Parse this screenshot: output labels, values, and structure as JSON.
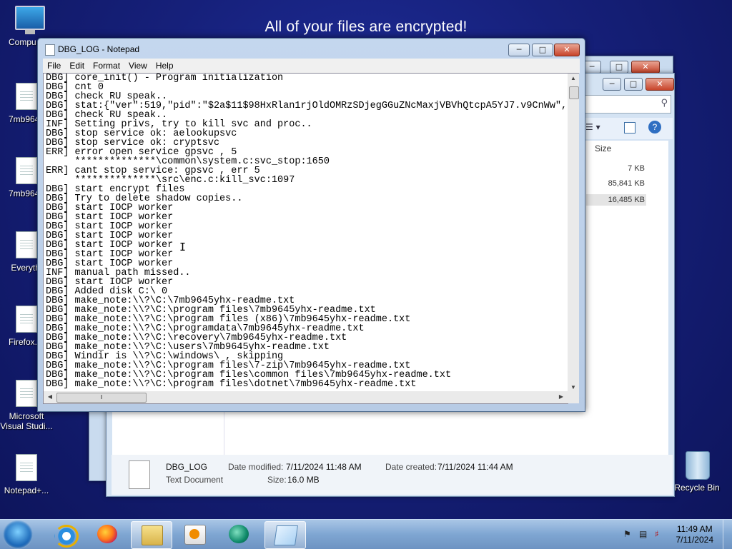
{
  "desktop": {
    "banner": "All of your files are encrypted!",
    "icons": [
      {
        "label": "Compu"
      },
      {
        "label": "7mb9645"
      },
      {
        "label": "7mb9645"
      },
      {
        "label": "Everythi"
      },
      {
        "label": "Firefox.In"
      },
      {
        "label": "Microsoft Visual Studi..."
      },
      {
        "label": "Notepad+..."
      },
      {
        "label": "Recycle Bin"
      }
    ]
  },
  "notepad": {
    "title": "DBG_LOG - Notepad",
    "menu": [
      "File",
      "Edit",
      "Format",
      "View",
      "Help"
    ],
    "lines": [
      "DBG] core_init() - Program initialization",
      "DBG] cnt 0",
      "DBG] check RU speak..",
      "DBG] stat:{\"ver\":519,\"pid\":\"$2a$11$98HxRlan1rjOldOMRzSDjegGGuZNcMaxjVBVhQtcpA5YJ7.v9CnWw\",\"",
      "DBG] check RU speak..",
      "INF] Setting privs, try to kill svc and proc..",
      "DBG] stop service ok: aelookupsvc",
      "DBG] stop service ok: cryptsvc",
      "ERR] error open service gpsvc , 5",
      "     **************\\common\\system.c:svc_stop:1650",
      "ERR] cant stop service: gpsvc , err 5",
      "     **************\\src\\enc.c:kill_svc:1097",
      "DBG] start encrypt files",
      "DBG] Try to delete shadow copies..",
      "DBG] start IOCP worker",
      "DBG] start IOCP worker",
      "DBG] start IOCP worker",
      "DBG] start IOCP worker",
      "DBG] start IOCP worker",
      "DBG] start IOCP worker",
      "DBG] start IOCP worker",
      "INF] manual path missed..",
      "DBG] start IOCP worker",
      "DBG] Added disk C:\\ 0",
      "DBG] make_note:\\\\?\\C:\\7mb9645yhx-readme.txt",
      "DBG] make_note:\\\\?\\C:\\program files\\7mb9645yhx-readme.txt",
      "DBG] make_note:\\\\?\\C:\\program files (x86)\\7mb9645yhx-readme.txt",
      "DBG] make_note:\\\\?\\C:\\programdata\\7mb9645yhx-readme.txt",
      "DBG] make_note:\\\\?\\C:\\recovery\\7mb9645yhx-readme.txt",
      "DBG] make_note:\\\\?\\C:\\users\\7mb9645yhx-readme.txt",
      "DBG] Windir is \\\\?\\C:\\windows\\ , skipping",
      "DBG] make_note:\\\\?\\C:\\program files\\7-zip\\7mb9645yhx-readme.txt",
      "DBG] make_note:\\\\?\\C:\\program files\\common files\\7mb9645yhx-readme.txt",
      "DBG] make_note:\\\\?\\C:\\program files\\dotnet\\7mb9645yhx-readme.txt"
    ]
  },
  "explorer": {
    "size_header": "Size",
    "sizes": [
      "7 KB",
      "85,841 KB",
      "16,485 KB"
    ],
    "details": {
      "name": "DBG_LOG",
      "type": "Text Document",
      "modified_label": "Date modified:",
      "modified_value": "7/11/2024 11:48 AM",
      "created_label": "Date created:",
      "created_value": "7/11/2024 11:44 AM",
      "size_label": "Size:",
      "size_value": "16.0 MB"
    }
  },
  "taskbar": {
    "time": "11:49 AM",
    "date": "7/11/2024"
  }
}
